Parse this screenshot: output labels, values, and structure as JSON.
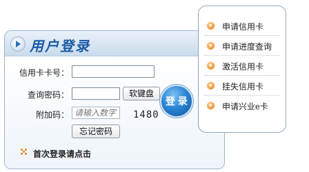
{
  "login": {
    "title": "用户登录",
    "card_label": "信用卡卡号：",
    "card_value": "",
    "password_label": "查询密码：",
    "password_value": "",
    "keyboard_button": "软键盘",
    "captcha_label": "附加码：",
    "captcha_placeholder": "请输入数字",
    "captcha_code": "1480",
    "forgot_button": "忘记密码",
    "login_button": "登 录",
    "first_login": "首次登录请点击"
  },
  "menu": {
    "items": [
      {
        "label": "申请信用卡",
        "icon": "arrow-bullet-icon"
      },
      {
        "label": "申请进度查询",
        "icon": "arrow-bullet-icon"
      },
      {
        "label": "激活信用卡",
        "icon": "arrow-bullet-icon"
      },
      {
        "label": "挂失信用卡",
        "icon": "arrow-bullet-icon"
      },
      {
        "label": "申请兴业e卡",
        "icon": "arrow-bullet-icon"
      }
    ]
  },
  "colors": {
    "title": "#1c5aa6",
    "login_button": "#2a86d6",
    "menu_bullet": "#f29a3a",
    "panel_border": "#9fb4cc"
  }
}
